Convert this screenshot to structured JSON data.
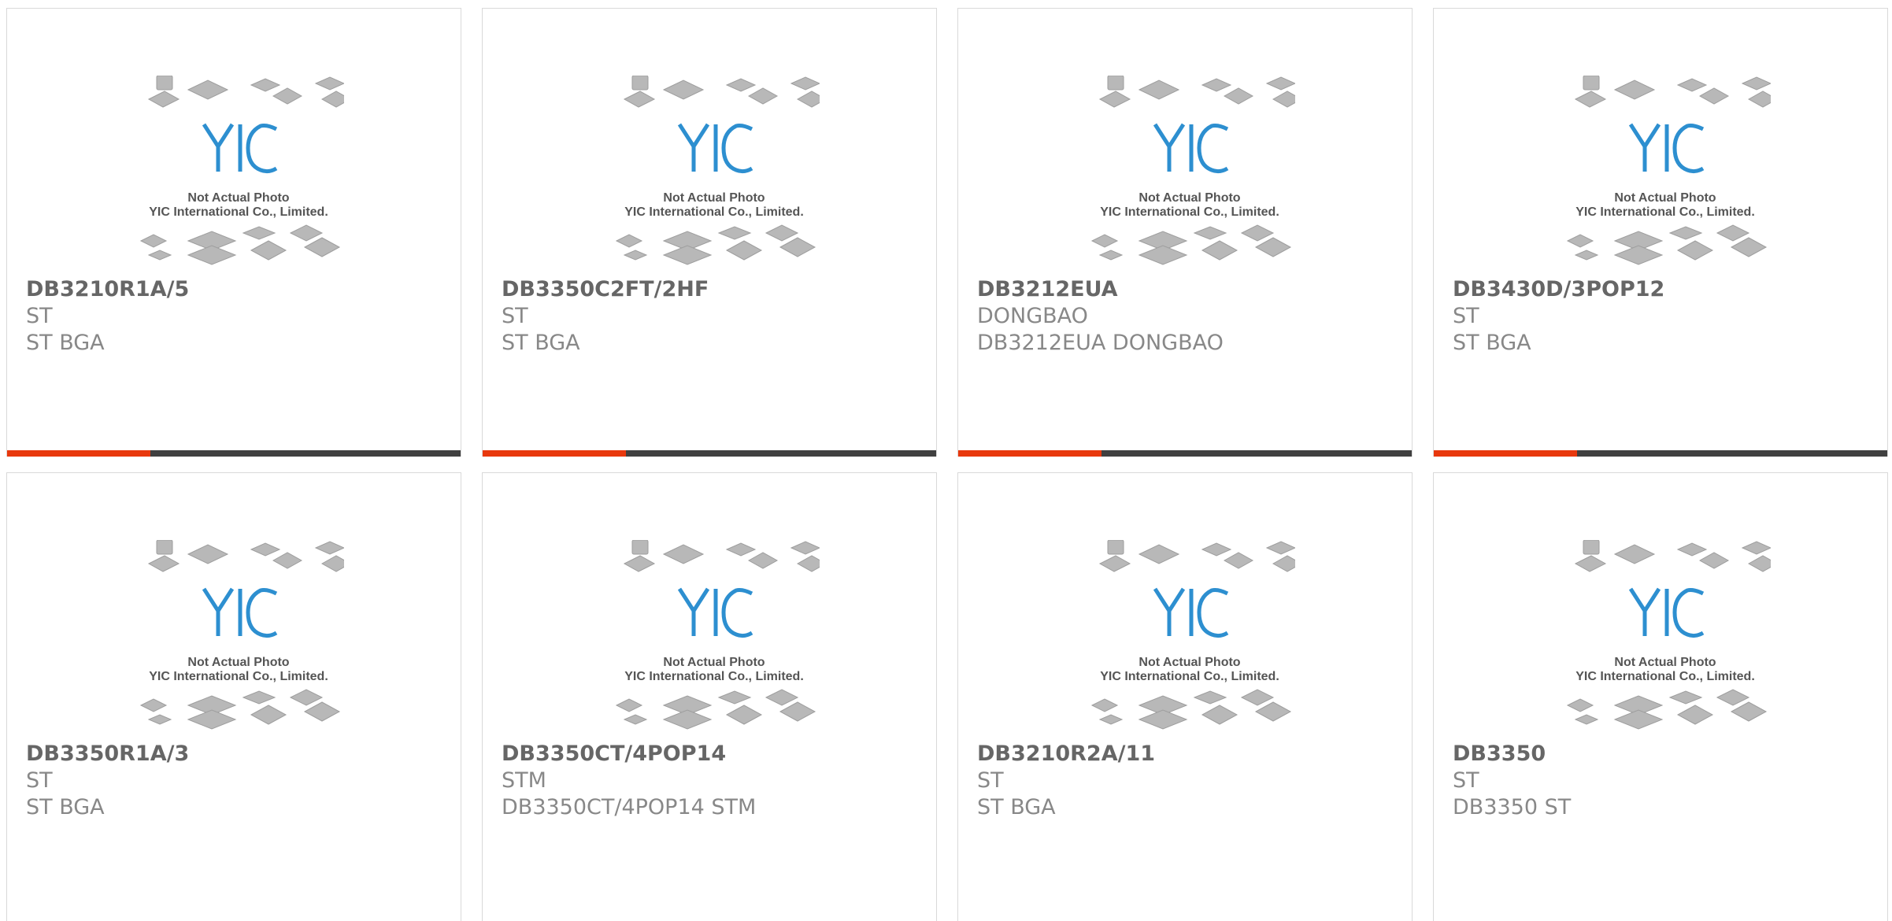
{
  "placeholder": {
    "line1": "Not Actual Photo",
    "line2": "YIC International Co., Limited.",
    "logo": "YIC"
  },
  "colors": {
    "accent": "#e8380d",
    "bar": "#404040",
    "logo_blue": "#2d8fd0",
    "chip_gray": "#b8b8b8"
  },
  "products": [
    {
      "part": "DB3210R1A/5",
      "brand": "ST",
      "desc": "ST BGA"
    },
    {
      "part": "DB3350C2FT/2HF",
      "brand": "ST",
      "desc": "ST BGA"
    },
    {
      "part": "DB3212EUA",
      "brand": "DONGBAO",
      "desc": "DB3212EUA DONGBAO"
    },
    {
      "part": "DB3430D/3POP12",
      "brand": "ST",
      "desc": "ST BGA"
    },
    {
      "part": "DB3350R1A/3",
      "brand": "ST",
      "desc": "ST BGA"
    },
    {
      "part": "DB3350CT/4POP14",
      "brand": "STM",
      "desc": "DB3350CT/4POP14 STM"
    },
    {
      "part": "DB3210R2A/11",
      "brand": "ST",
      "desc": "ST BGA"
    },
    {
      "part": "DB3350",
      "brand": "ST",
      "desc": "DB3350 ST"
    }
  ]
}
